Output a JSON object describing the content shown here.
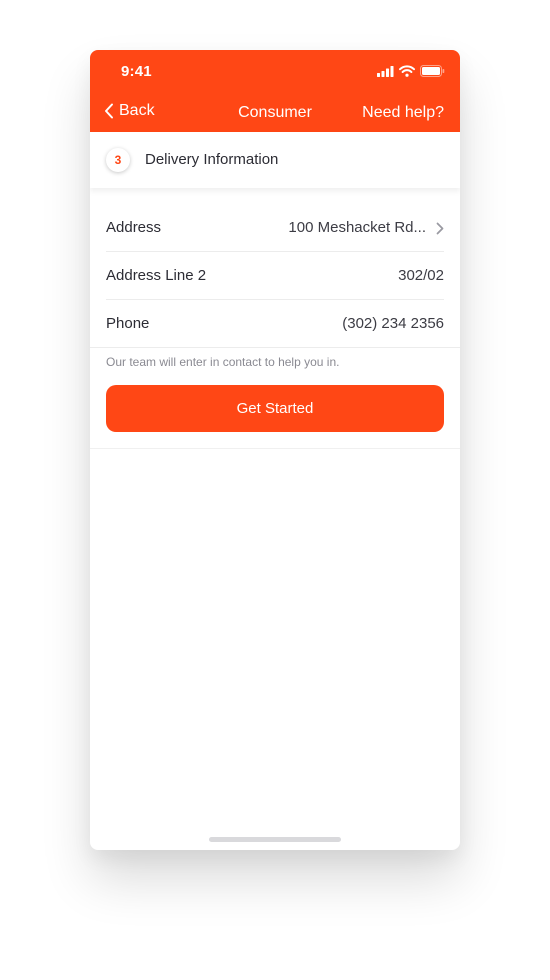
{
  "status_bar": {
    "time": "9:41",
    "icons": [
      "signal-icon",
      "wifi-icon",
      "battery-icon"
    ]
  },
  "nav": {
    "back_label": "Back",
    "title": "Consumer",
    "help_label": "Need help?"
  },
  "step": {
    "number": "3",
    "title": "Delivery Information"
  },
  "form": {
    "rows": [
      {
        "label": "Address",
        "value": "100 Meshacket Rd..."
      },
      {
        "label": "Address Line 2",
        "value": "302/02"
      },
      {
        "label": "Phone",
        "value": "(302) 234 2356"
      }
    ]
  },
  "helper_text": "Our team will enter in contact to help you in.",
  "cta_label": "Get Started",
  "colors": {
    "accent": "#FF4715",
    "text_primary": "#2c2c34",
    "text_secondary": "#8a8a92"
  }
}
